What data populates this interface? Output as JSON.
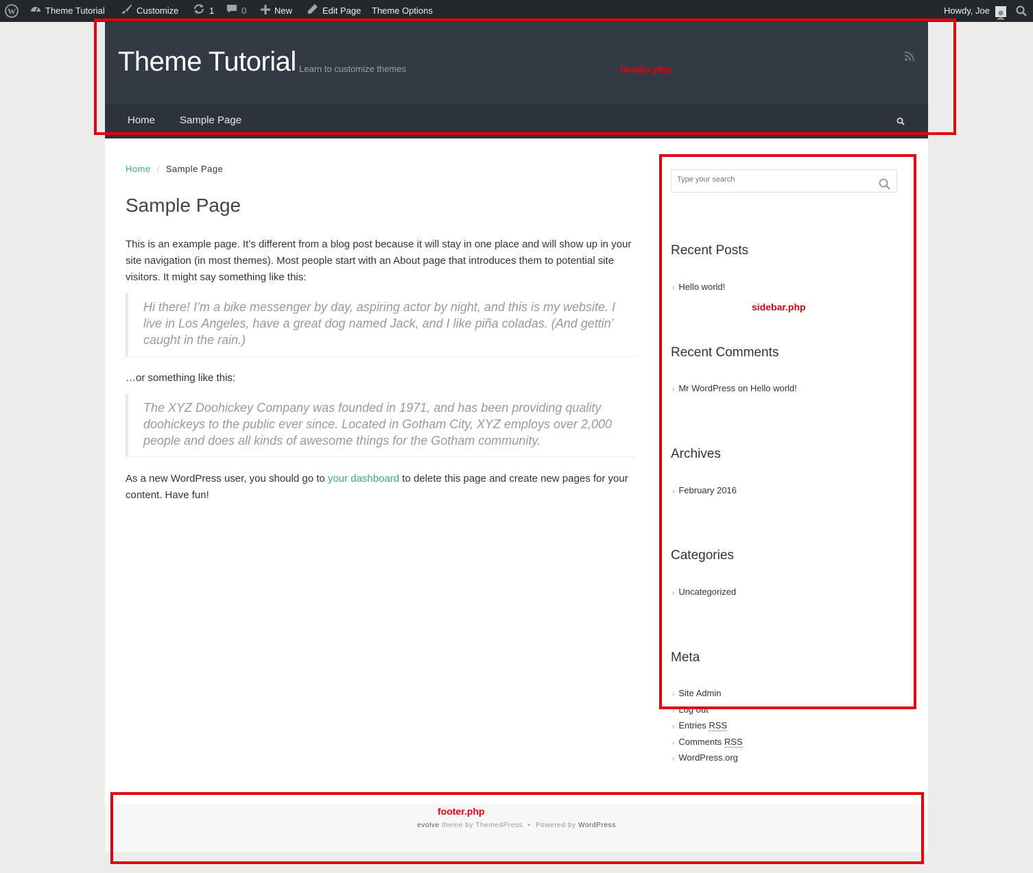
{
  "admin_bar": {
    "site_name": "Theme Tutorial",
    "customize": "Customize",
    "updates_count": "1",
    "comments_count": "0",
    "new": "New",
    "edit_page": "Edit Page",
    "theme_options": "Theme Options",
    "howdy": "Howdy, Joe"
  },
  "header": {
    "site_title": "Theme Tutorial",
    "tagline": "Learn to customize themes",
    "nav": [
      "Home",
      "Sample Page"
    ]
  },
  "breadcrumb": {
    "home": "Home",
    "separator": "/",
    "current": "Sample Page"
  },
  "content": {
    "title": "Sample Page",
    "p1": "This is an example page. It’s different from a blog post because it will stay in one place and will show up in your site navigation (in most themes). Most people start with an About page that introduces them to potential site visitors. It might say something like this:",
    "quote1": "Hi there! I’m a bike messenger by day, aspiring actor by night, and this is my website. I live in Los Angeles, have a great dog named Jack, and I like piña coladas. (And gettin’ caught in the rain.)",
    "p2": "…or something like this:",
    "quote2": "The XYZ Doohickey Company was founded in 1971, and has been providing quality doohickeys to the public ever since. Located in Gotham City, XYZ employs over 2,000 people and does all kinds of awesome things for the Gotham community.",
    "p3_before": "As a new WordPress user, you should go to ",
    "p3_link": "your dashboard",
    "p3_after": " to delete this page and create new pages for your content. Have fun!"
  },
  "sidebar": {
    "search_placeholder": "Type your search",
    "recent_posts": {
      "title": "Recent Posts",
      "items": [
        "Hello world!"
      ]
    },
    "recent_comments": {
      "title": "Recent Comments",
      "author": "Mr WordPress",
      "on": " on ",
      "post": "Hello world!"
    },
    "archives": {
      "title": "Archives",
      "items": [
        "February 2016"
      ]
    },
    "categories": {
      "title": "Categories",
      "items": [
        "Uncategorized"
      ]
    },
    "meta": {
      "title": "Meta",
      "site_admin": "Site Admin",
      "log_out": "Log out",
      "entries": "Entries ",
      "comments": "Comments ",
      "rss": "RSS",
      "wordpress_org": "WordPress.org"
    }
  },
  "footer": {
    "theme": "evolve",
    "theme_by": " theme by ",
    "author": "Theme4Press",
    "bullet": "•",
    "powered_by": "Powered by ",
    "wordpress": "WordPress"
  },
  "annotations": {
    "header_label": "header.php",
    "sidebar_label": "sidebar.php",
    "footer_label": "footer.php",
    "color": "#e3000f"
  },
  "colors": {
    "admin_bar": "#23282d",
    "header_bg": "#323a44",
    "nav_bg": "#2c333c",
    "accent_link": "#3aa39a"
  }
}
